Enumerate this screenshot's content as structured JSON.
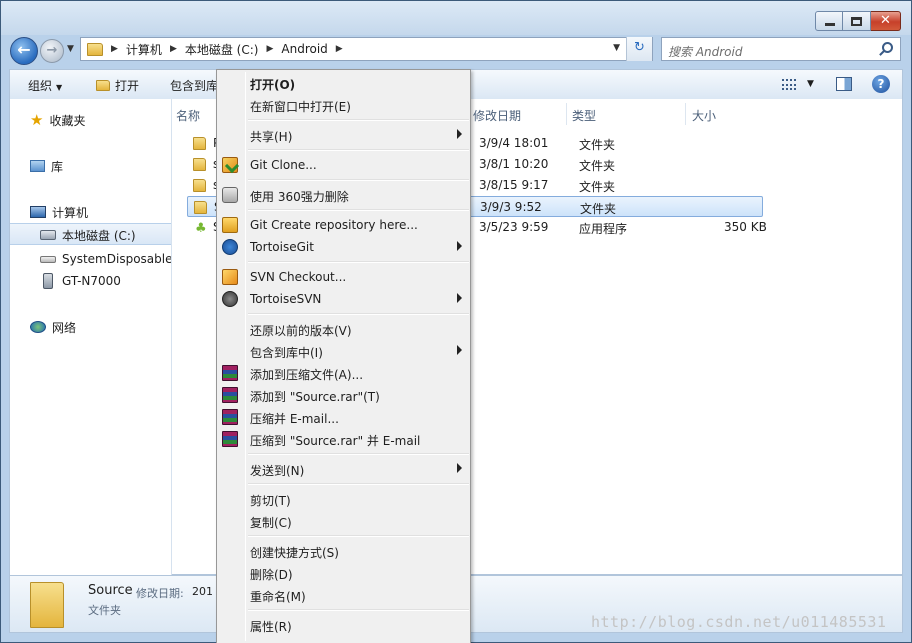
{
  "window": {
    "controls": {
      "minimize": "–",
      "maximize": "□",
      "close": "✕"
    }
  },
  "nav": {
    "back": "←",
    "forward": "→",
    "breadcrumb": [
      "计算机",
      "本地磁盘 (C:)",
      "Android"
    ],
    "search_placeholder": "搜索 Android"
  },
  "toolbar": {
    "organize": "组织",
    "open": "打开",
    "include": "包含到库",
    "help": "?"
  },
  "sidebar": {
    "favorites": "收藏夹",
    "libraries": "库",
    "computer": "计算机",
    "drives": [
      "本地磁盘 (C:)",
      "SystemDisposableI",
      "GT-N7000"
    ],
    "network": "网络"
  },
  "columns": {
    "name": "名称",
    "date": "修改日期",
    "type": "类型",
    "size": "大小"
  },
  "files": [
    {
      "name": "P",
      "date": "3/9/4 18:01",
      "type": "文件夹",
      "size": "",
      "icon": "folder"
    },
    {
      "name": "s",
      "date": "3/8/1 10:20",
      "type": "文件夹",
      "size": "",
      "icon": "folder"
    },
    {
      "name": "s",
      "date": "3/8/15 9:17",
      "type": "文件夹",
      "size": "",
      "icon": "folder"
    },
    {
      "name": "S",
      "date": "3/9/3 9:52",
      "type": "文件夹",
      "size": "",
      "icon": "folder",
      "selected": true
    },
    {
      "name": "S",
      "date": "3/5/23 9:59",
      "type": "应用程序",
      "size": "350 KB",
      "icon": "android-app"
    }
  ],
  "context_menu": {
    "open": "打开(O)",
    "open_new_window": "在新窗口中打开(E)",
    "share": "共享(H)",
    "git_clone": "Git Clone...",
    "force_delete_360": "使用 360强力删除",
    "git_create_repo": "Git Create repository here...",
    "tortoise_git": "TortoiseGit",
    "svn_checkout": "SVN Checkout...",
    "tortoise_svn": "TortoiseSVN",
    "restore_previous": "还原以前的版本(V)",
    "include_in_library": "包含到库中(I)",
    "add_to_archive": "添加到压缩文件(A)...",
    "add_to_source_rar": "添加到 \"Source.rar\"(T)",
    "compress_email": "压缩并 E-mail...",
    "compress_source_email": "压缩到 \"Source.rar\" 并 E-mail",
    "send_to": "发送到(N)",
    "cut": "剪切(T)",
    "copy": "复制(C)",
    "create_shortcut": "创建快捷方式(S)",
    "delete": "删除(D)",
    "rename": "重命名(M)",
    "properties": "属性(R)"
  },
  "details": {
    "name": "Source",
    "modified_label": "修改日期:",
    "modified_value": "201",
    "type": "文件夹"
  },
  "watermark": "http://blog.csdn.net/u011485531"
}
